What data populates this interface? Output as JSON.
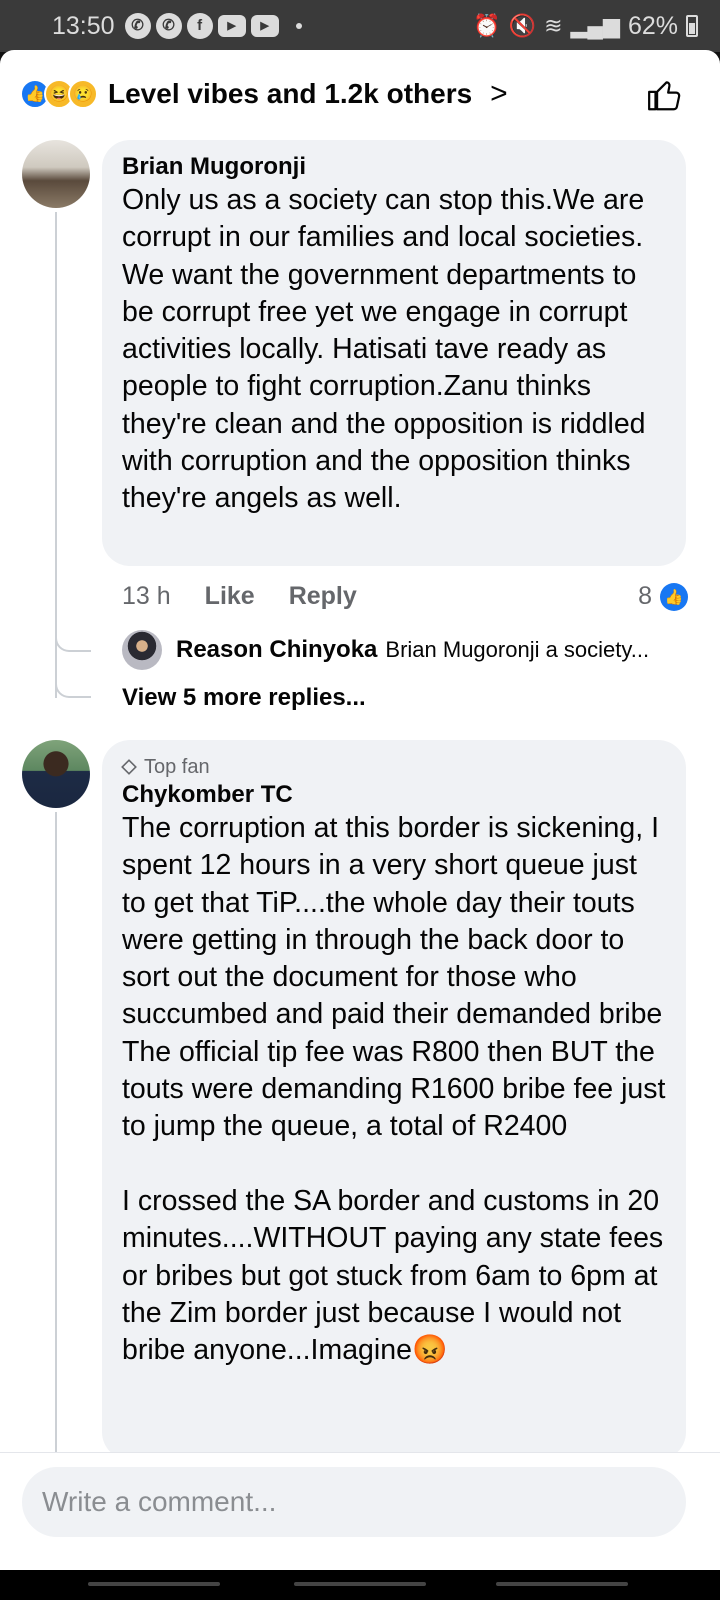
{
  "status_bar": {
    "time": "13:50",
    "left_icons": [
      "whatsapp-icon",
      "whatsapp-icon",
      "facebook-icon",
      "youtube-icon",
      "youtube-icon",
      "dot-icon"
    ],
    "right_icons": [
      "alarm-icon",
      "mute-icon",
      "wifi-icon",
      "signal-icon",
      "battery-icon"
    ],
    "battery": "62%"
  },
  "reactions": {
    "icons": [
      "like",
      "haha",
      "sad"
    ],
    "text": "Level vibes and 1.2k others",
    "chevron": ">"
  },
  "comments": [
    {
      "author": "Brian Mugoronji",
      "badge": "",
      "text": "Only us as a society  can stop this.We are corrupt in our families and  local societies. We want the government departments  to be corrupt free yet we engage  in  corrupt activities  locally. Hatisati tave ready as people to  fight corruption.Zanu thinks they're  clean and the opposition  is  riddled with corruption  and the opposition  thinks they're  angels as well.",
      "time": "13 h",
      "like_label": "Like",
      "reply_label": "Reply",
      "like_count": "8",
      "reply_preview": {
        "author": "Reason Chinyoka",
        "snippet": "Brian Mugoronji a society..."
      },
      "view_more": "View 5 more replies..."
    },
    {
      "author": "Chykomber TC",
      "badge": "Top fan",
      "text": "The corruption at this border is sickening, I spent 12 hours in a very short queue just to get that TiP....the whole day their touts were getting in through the back door to sort out the document for those who succumbed and paid their demanded bribe\nThe official tip fee was R800 then BUT the touts were demanding R1600 bribe fee just to jump the queue, a total of R2400\n\nI crossed the SA border and customs in 20 minutes....WITHOUT paying any state fees or bribes but got stuck from 6am to 6pm at the Zim border just because I would not bribe anyone...Imagine😡"
    }
  ],
  "composer": {
    "placeholder": "Write a comment..."
  },
  "colors": {
    "accent": "#1877f2",
    "bubble": "#f0f2f5",
    "secondary_text": "#65676b"
  }
}
